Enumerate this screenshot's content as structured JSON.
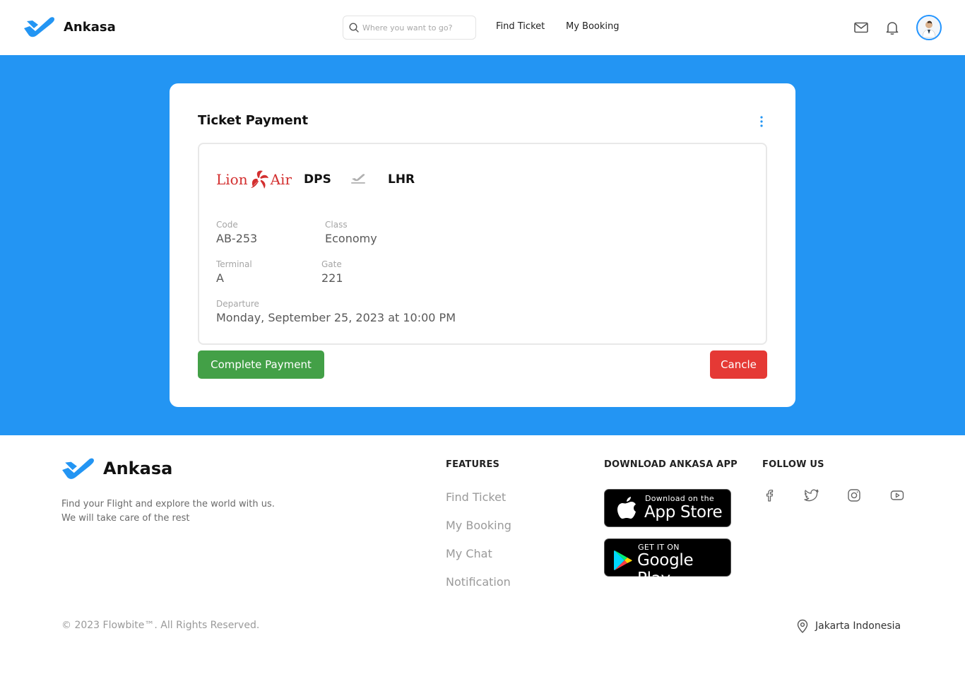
{
  "brand": {
    "name": "Ankasa"
  },
  "colors": {
    "primary": "#2395f3",
    "complete": "#43a047",
    "cancel": "#e53935",
    "airline": "#d32f2f"
  },
  "header": {
    "search_placeholder": "Where you want to go?",
    "nav": {
      "find_ticket": "Find Ticket",
      "my_booking": "My Booking"
    },
    "icons": [
      "mail-icon",
      "bell-icon",
      "avatar"
    ]
  },
  "card": {
    "title": "Ticket Payment",
    "airline": {
      "part1": "Lion",
      "part2": "Air"
    },
    "route": {
      "from": "DPS",
      "to": "LHR"
    },
    "fields": {
      "code": {
        "label": "Code",
        "value": "AB-253"
      },
      "class": {
        "label": "Class",
        "value": "Economy"
      },
      "terminal": {
        "label": "Terminal",
        "value": "A"
      },
      "gate": {
        "label": "Gate",
        "value": "221"
      },
      "departure": {
        "label": "Departure",
        "value": "Monday, September 25, 2023 at 10:00 PM"
      }
    },
    "buttons": {
      "complete": "Complete Payment",
      "cancel": "Cancle"
    }
  },
  "footer": {
    "brand": "Ankasa",
    "description": "Find your Flight and explore the world with us. We will take care of the rest",
    "features": {
      "title": "FEATURES",
      "items": [
        "Find Ticket",
        "My Booking",
        "My Chat",
        "Notification"
      ]
    },
    "download": {
      "title": "DOWNLOAD ANKASA APP",
      "app_store": {
        "small": "Download on the",
        "big": "App Store"
      },
      "google_play": {
        "small": "GET IT ON",
        "big": "Google Play"
      }
    },
    "follow": {
      "title": "FOLLOW US",
      "icons": [
        "facebook-icon",
        "twitter-icon",
        "instagram-icon",
        "youtube-icon"
      ]
    },
    "copyright": "© 2023 Flowbite™. All Rights Reserved.",
    "location": "Jakarta Indonesia"
  }
}
